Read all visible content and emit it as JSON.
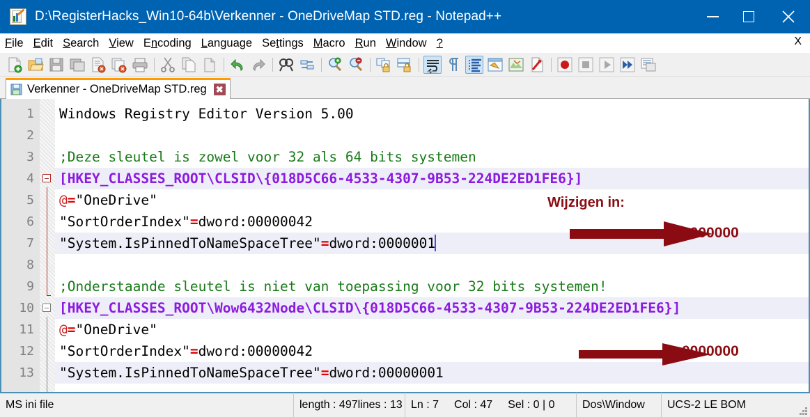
{
  "window": {
    "title": "D:\\RegisterHacks_Win10-64b\\Verkenner - OneDriveMap STD.reg - Notepad++",
    "icon": "notepad-plus-plus-icon",
    "minimize_label": "Minimize",
    "maximize_label": "Maximize",
    "close_label": "Close",
    "titlebar_color": "#0063b1"
  },
  "menu": {
    "items": [
      {
        "label": "File",
        "accel": "F"
      },
      {
        "label": "Edit",
        "accel": "E"
      },
      {
        "label": "Search",
        "accel": "S"
      },
      {
        "label": "View",
        "accel": "V"
      },
      {
        "label": "Encoding",
        "accel": "n"
      },
      {
        "label": "Language",
        "accel": "L"
      },
      {
        "label": "Settings",
        "accel": "t"
      },
      {
        "label": "Macro",
        "accel": "M"
      },
      {
        "label": "Run",
        "accel": "R"
      },
      {
        "label": "Window",
        "accel": "W"
      },
      {
        "label": "?",
        "accel": ""
      }
    ],
    "close_document_label": "X"
  },
  "toolbar": {
    "buttons": [
      {
        "name": "new-file-icon",
        "tip": "New"
      },
      {
        "name": "open-file-icon",
        "tip": "Open"
      },
      {
        "name": "save-icon",
        "tip": "Save"
      },
      {
        "name": "save-all-icon",
        "tip": "Save All"
      },
      {
        "name": "close-file-icon",
        "tip": "Close"
      },
      {
        "name": "close-all-icon",
        "tip": "Close All"
      },
      {
        "name": "print-icon",
        "tip": "Print"
      },
      {
        "sep": true
      },
      {
        "name": "cut-icon",
        "tip": "Cut"
      },
      {
        "name": "copy-icon",
        "tip": "Copy"
      },
      {
        "name": "paste-icon",
        "tip": "Paste"
      },
      {
        "sep": true
      },
      {
        "name": "undo-icon",
        "tip": "Undo"
      },
      {
        "name": "redo-icon",
        "tip": "Redo"
      },
      {
        "sep": true
      },
      {
        "name": "find-icon",
        "tip": "Find"
      },
      {
        "name": "replace-icon",
        "tip": "Replace"
      },
      {
        "sep": true
      },
      {
        "name": "zoom-in-icon",
        "tip": "Zoom In"
      },
      {
        "name": "zoom-out-icon",
        "tip": "Zoom Out"
      },
      {
        "sep": true
      },
      {
        "name": "sync-vertical-icon",
        "tip": "Synchronize Vertical Scrolling"
      },
      {
        "name": "sync-horizontal-icon",
        "tip": "Synchronize Horizontal Scrolling"
      },
      {
        "sep": true
      },
      {
        "name": "word-wrap-icon",
        "tip": "Word wrap",
        "active": true
      },
      {
        "name": "show-all-characters-icon",
        "tip": "Show All Characters"
      },
      {
        "name": "indent-guide-icon",
        "tip": "Show Indent Guide",
        "active": true
      },
      {
        "name": "user-defined-dialog-icon",
        "tip": "User Defined Dialogue"
      },
      {
        "name": "document-map-icon",
        "tip": "Document Map"
      },
      {
        "name": "function-list-icon",
        "tip": "Function List"
      },
      {
        "sep": true
      },
      {
        "name": "record-macro-icon",
        "tip": "Start Recording"
      },
      {
        "name": "stop-macro-icon",
        "tip": "Stop Recording"
      },
      {
        "name": "play-macro-icon",
        "tip": "Playback"
      },
      {
        "name": "run-macro-multiple-icon",
        "tip": "Run a Macro Multiple Times"
      },
      {
        "name": "save-macro-icon",
        "tip": "Save Current Recorded Macro"
      }
    ]
  },
  "tabs": [
    {
      "label": "Verkenner - OneDriveMap STD.reg",
      "icon": "saved-file-icon",
      "close": "✖",
      "active": true
    }
  ],
  "editor": {
    "lines": [
      {
        "num": "1",
        "highlight": false,
        "tokens": [
          {
            "t": "Windows Registry Editor Version 5.00",
            "c": "plain"
          }
        ]
      },
      {
        "num": "2",
        "highlight": false,
        "tokens": [
          {
            "t": "",
            "c": "plain"
          }
        ]
      },
      {
        "num": "3",
        "highlight": false,
        "tokens": [
          {
            "t": ";Deze sleutel is zowel voor 32 als 64 bits systemen",
            "c": "comment"
          }
        ]
      },
      {
        "num": "4",
        "highlight": true,
        "tokens": [
          {
            "t": "[HKEY_CLASSES_ROOT\\CLSID\\{018D5C66-4533-4307-9B53-224DE2ED1FE6}]",
            "c": "key"
          }
        ]
      },
      {
        "num": "5",
        "highlight": false,
        "tokens": [
          {
            "t": "@",
            "c": "at"
          },
          {
            "t": "=",
            "c": "eq"
          },
          {
            "t": "\"OneDrive\"",
            "c": "plain"
          }
        ]
      },
      {
        "num": "6",
        "highlight": false,
        "tokens": [
          {
            "t": "\"SortOrderIndex\"",
            "c": "plain"
          },
          {
            "t": "=",
            "c": "eq"
          },
          {
            "t": "dword:00000042",
            "c": "plain"
          }
        ]
      },
      {
        "num": "7",
        "highlight": true,
        "tokens": [
          {
            "t": "\"System.IsPinnedToNameSpaceTree\"",
            "c": "plain"
          },
          {
            "t": "=",
            "c": "eq"
          },
          {
            "t": "dword:0000001",
            "c": "plain"
          },
          {
            "t": "",
            "c": "caret"
          }
        ]
      },
      {
        "num": "8",
        "highlight": false,
        "tokens": [
          {
            "t": "",
            "c": "plain"
          }
        ]
      },
      {
        "num": "9",
        "highlight": false,
        "tokens": [
          {
            "t": ";Onderstaande sleutel is niet van toepassing voor 32 bits systemen!",
            "c": "comment"
          }
        ]
      },
      {
        "num": "10",
        "highlight": true,
        "tokens": [
          {
            "t": "[HKEY_CLASSES_ROOT\\Wow6432Node\\CLSID\\{018D5C66-4533-4307-9B53-224DE2ED1FE6}]",
            "c": "key"
          }
        ]
      },
      {
        "num": "11",
        "highlight": false,
        "tokens": [
          {
            "t": "@",
            "c": "at"
          },
          {
            "t": "=",
            "c": "eq"
          },
          {
            "t": "\"OneDrive\"",
            "c": "plain"
          }
        ]
      },
      {
        "num": "12",
        "highlight": false,
        "tokens": [
          {
            "t": "\"SortOrderIndex\"",
            "c": "plain"
          },
          {
            "t": "=",
            "c": "eq"
          },
          {
            "t": "dword:00000042",
            "c": "plain"
          }
        ]
      },
      {
        "num": "13",
        "highlight": true,
        "tokens": [
          {
            "t": "\"System.IsPinnedToNameSpaceTree\"",
            "c": "plain"
          },
          {
            "t": "=",
            "c": "eq"
          },
          {
            "t": "dword:00000001",
            "c": "plain"
          }
        ]
      }
    ]
  },
  "annotations": {
    "color": "#8a0c12",
    "label": "Wijzigen in:",
    "value_top": "0000000",
    "value_bottom": "0000000",
    "arrow_top": "arrow-right-icon",
    "arrow_bottom": "arrow-right-icon"
  },
  "statusbar": {
    "doc_type": "MS ini file",
    "length_label": "length : 497",
    "lines_label": "lines : 13",
    "ln": "Ln : 7",
    "col": "Col : 47",
    "sel": "Sel : 0 | 0",
    "eol": "Dos\\Window",
    "encoding": "UCS-2 LE BOM"
  }
}
